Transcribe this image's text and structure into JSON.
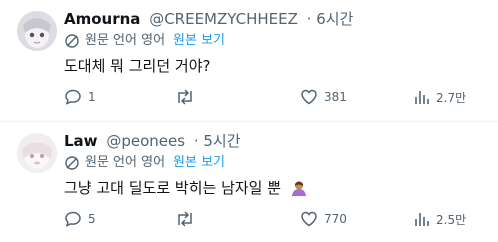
{
  "translate": {
    "original_label": "원문 언어 영어",
    "view_label": "원본 보기"
  },
  "tweets": [
    {
      "name": "Amourna",
      "handle": "@CREEMZYCHHEEZ",
      "time": "· 6시간",
      "text": "도대체 뭐 그리던 거야?",
      "replies": "1",
      "retweets": "",
      "likes": "381",
      "views": "2.7만"
    },
    {
      "name": "Law",
      "handle": "@peonees",
      "time": "· 5시간",
      "text": "그냥 고대 딜도로 박히는 남자일 뿐",
      "replies": "5",
      "retweets": "",
      "likes": "770",
      "views": "2.5만"
    }
  ]
}
